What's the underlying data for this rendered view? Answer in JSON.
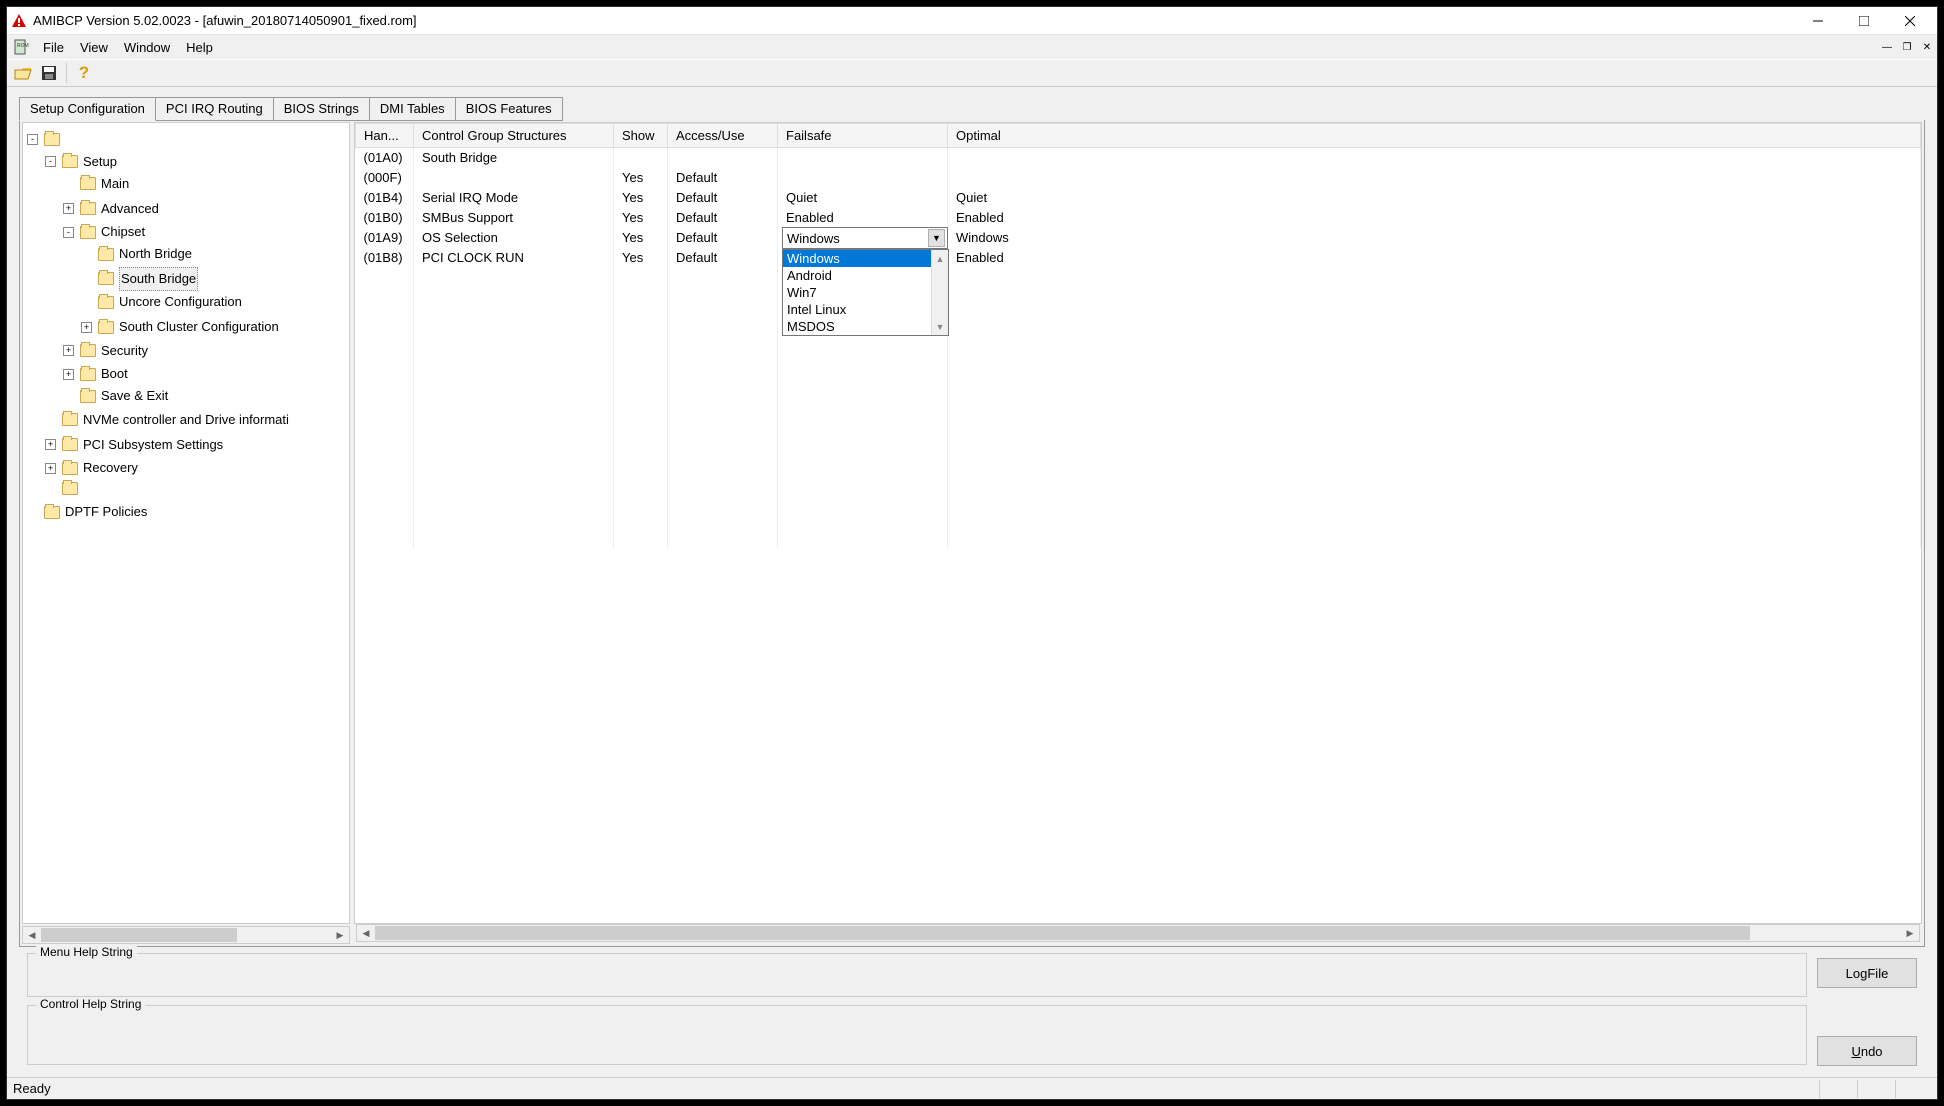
{
  "window": {
    "title": "AMIBCP Version 5.02.0023 - [afuwin_20180714050901_fixed.rom]"
  },
  "menu": [
    "File",
    "View",
    "Window",
    "Help"
  ],
  "tabs": [
    "Setup Configuration",
    "PCI IRQ Routing",
    "BIOS Strings",
    "DMI Tables",
    "BIOS Features"
  ],
  "tree": {
    "setup": "Setup",
    "main": "Main",
    "advanced": "Advanced",
    "chipset": "Chipset",
    "north_bridge": "North Bridge",
    "south_bridge": "South Bridge",
    "uncore": "Uncore Configuration",
    "south_cluster": "South Cluster Configuration",
    "security": "Security",
    "boot": "Boot",
    "save_exit": "Save & Exit",
    "nvme": "NVMe controller and Drive informati",
    "pci_sub": "PCI Subsystem Settings",
    "recovery": "Recovery",
    "dptf": "DPTF Policies"
  },
  "grid": {
    "headers": {
      "han": "Han...",
      "cgs": "Control Group Structures",
      "show": "Show",
      "access": "Access/Use",
      "fail": "Failsafe",
      "opt": "Optimal"
    },
    "rows": [
      {
        "han": "(01A0)",
        "cgs": "South Bridge",
        "show": "",
        "access": "",
        "fail": "",
        "opt": ""
      },
      {
        "han": "(000F)",
        "cgs": "",
        "show": "Yes",
        "access": "Default",
        "fail": "",
        "opt": ""
      },
      {
        "han": "(01B4)",
        "cgs": "Serial IRQ Mode",
        "show": "Yes",
        "access": "Default",
        "fail": "Quiet",
        "opt": "Quiet"
      },
      {
        "han": "(01B0)",
        "cgs": "SMBus Support",
        "show": "Yes",
        "access": "Default",
        "fail": "Enabled",
        "opt": "Enabled"
      },
      {
        "han": "(01A9)",
        "cgs": "OS Selection",
        "show": "Yes",
        "access": "Default",
        "fail": "Windows",
        "opt": "Windows"
      },
      {
        "han": "(01B8)",
        "cgs": "PCI CLOCK RUN",
        "show": "Yes",
        "access": "Default",
        "fail": "",
        "opt": "Enabled"
      }
    ]
  },
  "dropdown": {
    "selected": "Windows",
    "options": [
      "Windows",
      "Android",
      "Win7",
      "Intel Linux",
      "MSDOS"
    ]
  },
  "help": {
    "menu_legend": "Menu Help String",
    "control_legend": "Control Help String"
  },
  "buttons": {
    "logfile": "LogFile",
    "undo": "Undo"
  },
  "status": "Ready"
}
